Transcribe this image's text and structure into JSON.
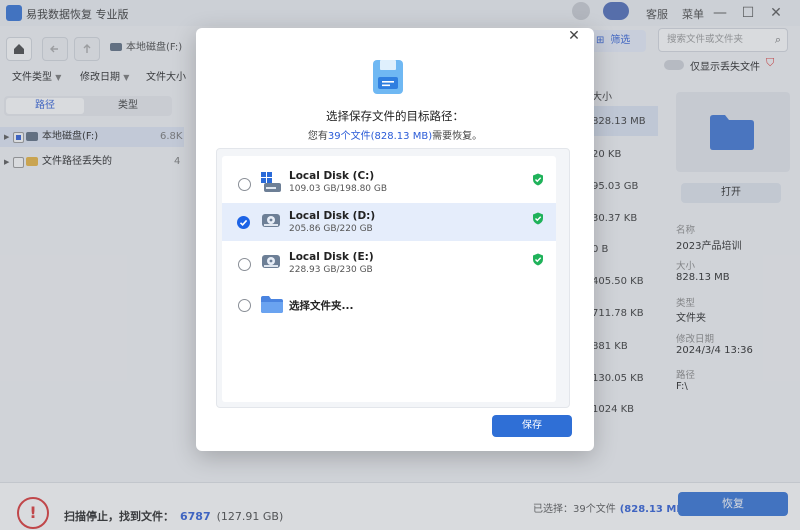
{
  "app": {
    "title": "易我数据恢复 专业版"
  },
  "window": {
    "service": "客服",
    "menu": "菜单",
    "minimize": "—",
    "maximize": "☐",
    "close": "✕"
  },
  "toolbar": {
    "path": "本地磁盘(F:)",
    "filter_label": "筛选",
    "search_placeholder": "搜索文件或文件夹"
  },
  "filters": {
    "file_type": "文件类型",
    "modified_date": "修改日期",
    "file_size": "文件大小",
    "show_lost_only": "仅显示丢失文件"
  },
  "left_panel": {
    "tabs": [
      "路径",
      "类型"
    ],
    "tree": [
      {
        "label": "本地磁盘(F:)",
        "count": "6.8K"
      },
      {
        "label": "文件路径丢失的",
        "count": "4"
      }
    ]
  },
  "table": {
    "size_header": "大小",
    "sizes": [
      "828.13 MB",
      "20 KB",
      "95.03 GB",
      "30.37 KB",
      "0 B",
      "405.50 KB",
      "711.78 KB",
      "881 KB",
      "130.05 KB",
      "1024 KB"
    ]
  },
  "details": {
    "open_button": "打开",
    "fields": [
      {
        "label": "名称",
        "value": "2023产品培训"
      },
      {
        "label": "大小",
        "value": "828.13 MB"
      },
      {
        "label": "类型",
        "value": "文件夹"
      },
      {
        "label": "修改日期",
        "value": "2024/3/4 13:36"
      },
      {
        "label": "路径",
        "value": "F:\\"
      }
    ]
  },
  "status": {
    "scan_text": "扫描停止，找到文件：",
    "found_count": "6787",
    "found_size": "(127.91 GB)",
    "selected_prefix": "已选择：39个文件",
    "selected_size": "(828.13 MB)",
    "recover_button": "恢复"
  },
  "modal": {
    "title": "选择保存文件的目标路径：",
    "subtitle_pre": "您有",
    "subtitle_highlight": "39个文件(828.13 MB)",
    "subtitle_post": "需要恢复。",
    "disks": [
      {
        "name": "Local Disk (C:)",
        "size": "109.03 GB/198.80 GB",
        "selected": false
      },
      {
        "name": "Local Disk (D:)",
        "size": "205.86 GB/220 GB",
        "selected": true
      },
      {
        "name": "Local Disk (E:)",
        "size": "228.93 GB/230 GB",
        "selected": false
      }
    ],
    "choose_folder": "选择文件夹...",
    "save_button": "保存"
  },
  "colors": {
    "accent": "#2f6fd6",
    "ok_green": "#1fb25a",
    "warn_red": "#d33333"
  }
}
